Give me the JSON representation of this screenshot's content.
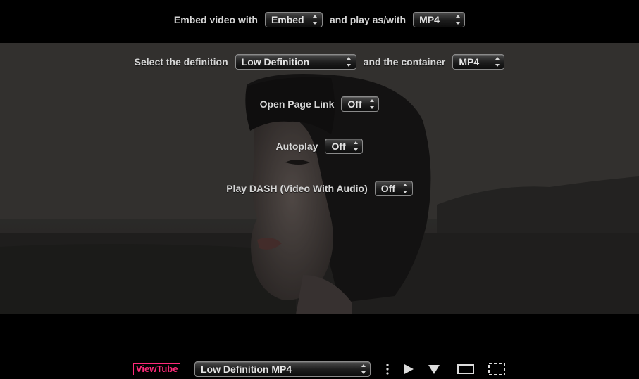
{
  "embed_row": {
    "label_embed": "Embed video with",
    "embed_value": "Embed",
    "label_play": "and play as/with",
    "play_value": "MP4"
  },
  "definition_row": {
    "label_def": "Select the definition",
    "def_value": "Low Definition",
    "label_container": "and the container",
    "container_value": "MP4"
  },
  "open_page_row": {
    "label": "Open Page Link",
    "value": "Off"
  },
  "autoplay_row": {
    "label": "Autoplay",
    "value": "Off"
  },
  "dash_row": {
    "label": "Play DASH (Video With Audio)",
    "value": "Off"
  },
  "toolbar": {
    "brand": "ViewTube",
    "video_select": "Low Definition MP4",
    "icons": [
      "more-vertical-icon",
      "play-icon",
      "download-icon",
      "window-icon",
      "fullscreen-icon"
    ]
  },
  "colors": {
    "brand": "#ff2a7a",
    "text": "#d6d6d6"
  }
}
